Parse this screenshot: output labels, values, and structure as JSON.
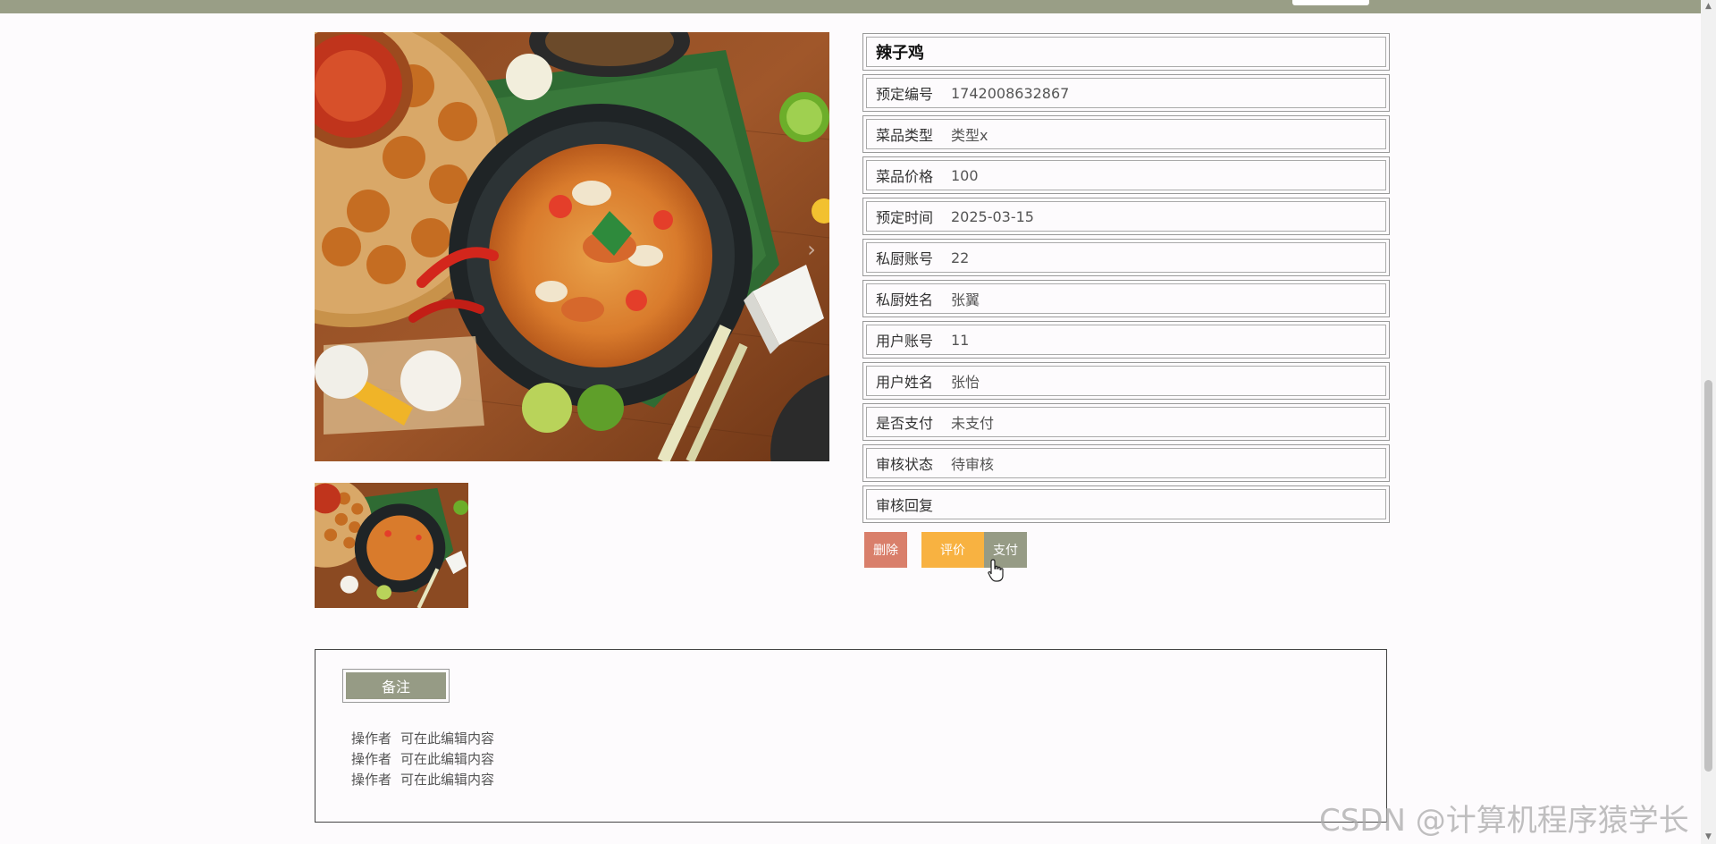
{
  "dish": {
    "title": "辣子鸡",
    "fields": [
      {
        "label": "预定编号",
        "value": "1742008632867"
      },
      {
        "label": "菜品类型",
        "value": "类型x"
      },
      {
        "label": "菜品价格",
        "value": "100"
      },
      {
        "label": "预定时间",
        "value": "2025-03-15"
      },
      {
        "label": "私厨账号",
        "value": "22"
      },
      {
        "label": "私厨姓名",
        "value": "张翼"
      },
      {
        "label": "用户账号",
        "value": "11"
      },
      {
        "label": "用户姓名",
        "value": "张怡"
      },
      {
        "label": "是否支付",
        "value": "未支付"
      },
      {
        "label": "审核状态",
        "value": "待审核"
      },
      {
        "label": "审核回复",
        "value": ""
      }
    ]
  },
  "actions": {
    "delete_label": "删除",
    "review_label": "评价",
    "pay_label": "支付"
  },
  "notes": {
    "tab_label": "备注",
    "lines": [
      {
        "author": "操作者",
        "content": "可在此编辑内容"
      },
      {
        "author": "操作者",
        "content": "可在此编辑内容"
      },
      {
        "author": "操作者",
        "content": "可在此编辑内容"
      }
    ]
  },
  "watermark": "CSDN @计算机程序猿学长",
  "colors": {
    "topbar": "#999e86",
    "delete": "#d97f6b",
    "review": "#f8b241",
    "pay": "#969b85"
  },
  "icons": {
    "carousel_next": "chevron-right-icon",
    "cursor": "hand-pointer-icon"
  }
}
